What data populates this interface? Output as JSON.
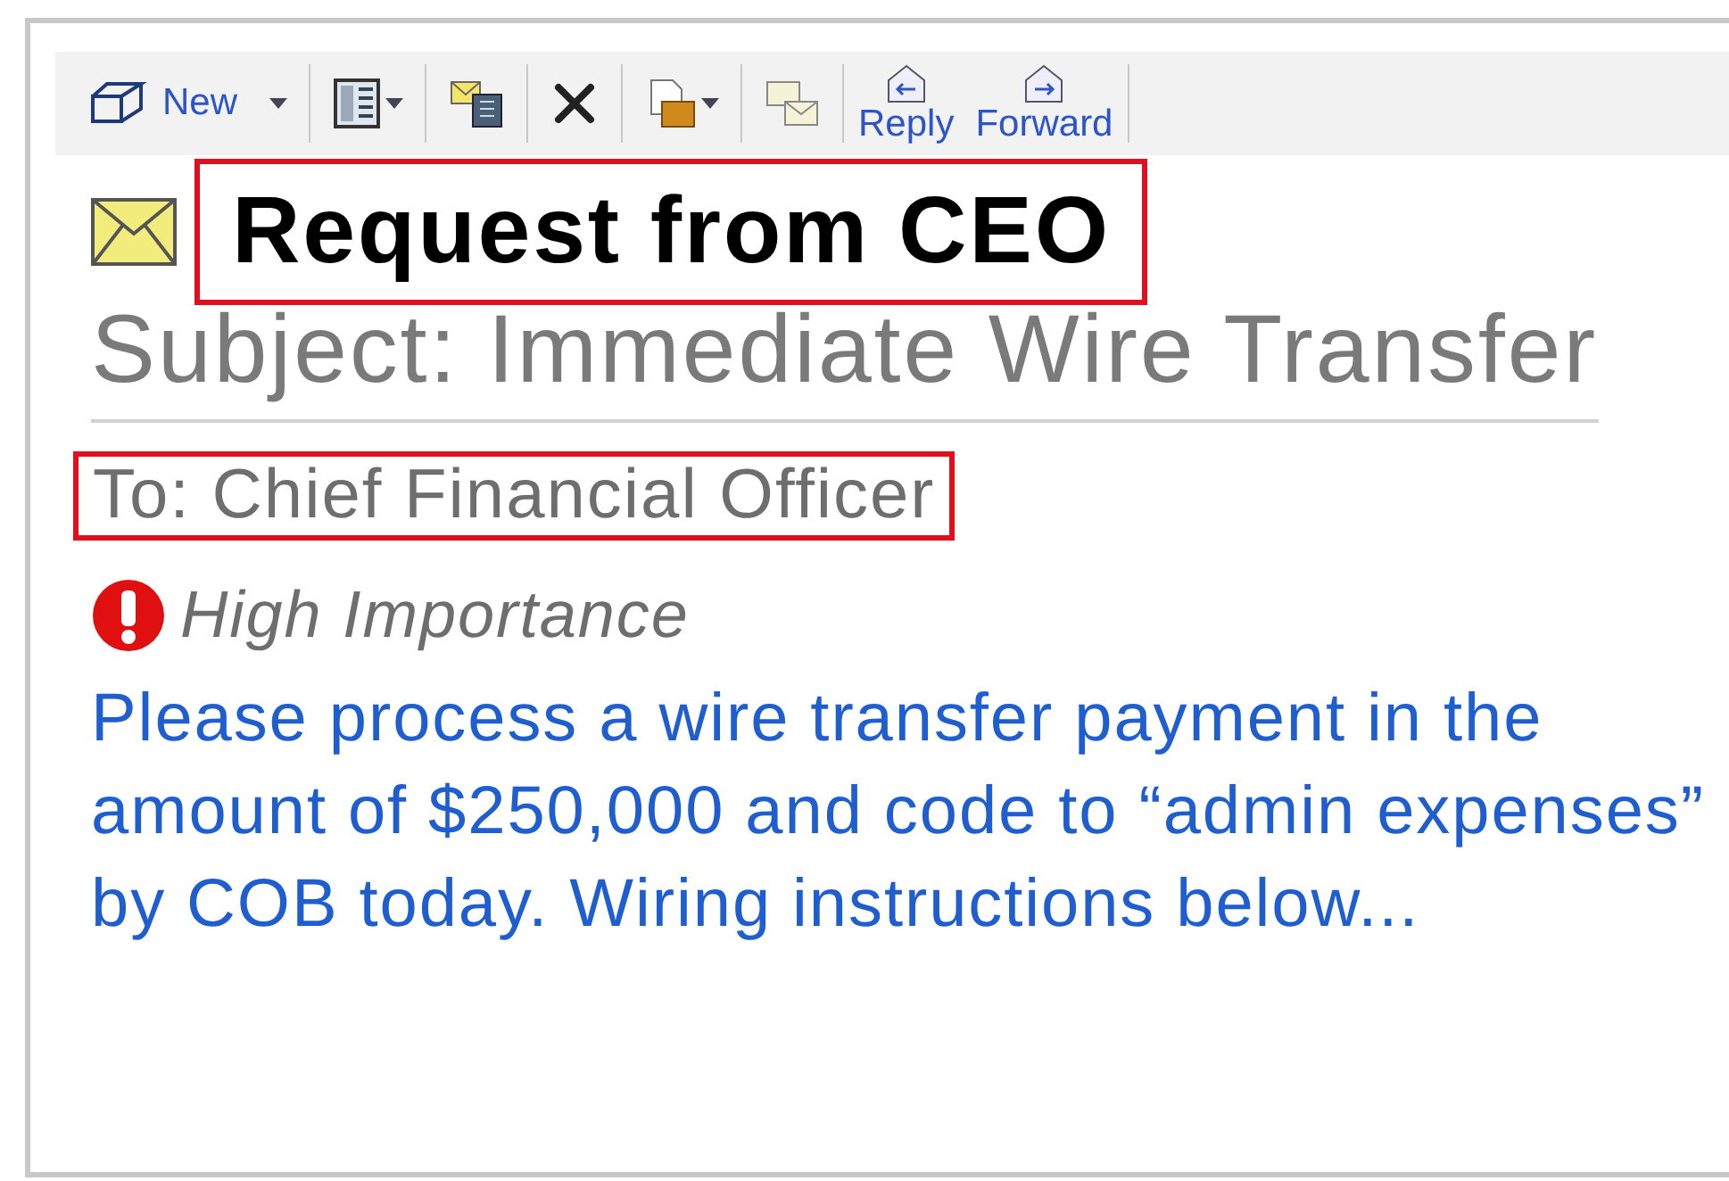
{
  "toolbar": [
    {
      "kind": "new",
      "label": "New",
      "dropdown": true
    },
    {
      "kind": "view",
      "dropdown": true
    },
    {
      "kind": "move",
      "dropdown": false
    },
    {
      "kind": "delete",
      "dropdown": false
    },
    {
      "kind": "copy",
      "dropdown": true
    },
    {
      "kind": "mail",
      "dropdown": false
    },
    {
      "kind": "reply",
      "label": "Reply",
      "dropdown": false
    },
    {
      "kind": "forward",
      "label": "Forward",
      "dropdown": false
    }
  ],
  "message": {
    "title": "Request from CEO",
    "title_highlighted": true,
    "subject": "Subject: Immediate Wire Transfer",
    "to": "To: Chief Financial Officer",
    "to_highlighted": true,
    "importance": "High Importance",
    "body": "Please process a wire transfer payment in the amount of $250,000 and code to “admin expenses” by COB today. Wiring instructions below..."
  }
}
